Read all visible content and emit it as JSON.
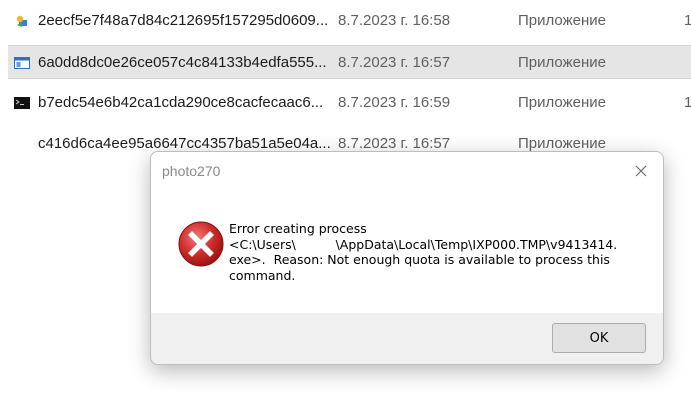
{
  "files": [
    {
      "name": "2eecf5e7f48a7d84c212695f157295d0609...",
      "date": "8.7.2023 г. 16:58",
      "type": "Приложение",
      "size": "1",
      "icon": "installer-icon",
      "selected": false
    },
    {
      "name": "6a0dd8dc0e26ce057c4c84133b4edfa555...",
      "date": "8.7.2023 г. 16:57",
      "type": "Приложение",
      "size": "",
      "icon": "app-window-icon",
      "selected": true
    },
    {
      "name": "b7edc54e6b42ca1cda290ce8cacfecaac6...",
      "date": "8.7.2023 г. 16:59",
      "type": "Приложение",
      "size": "1",
      "icon": "console-icon",
      "selected": false
    },
    {
      "name": "c416d6ca4ee95a6647cc4357ba51a5e04a...",
      "date": "8.7.2023 г. 16:57",
      "type": "Приложение",
      "size": "",
      "icon": "",
      "selected": false
    }
  ],
  "dialog": {
    "title": "photo270",
    "icon": "error-icon",
    "message_lines": [
      "Error creating process",
      "<C:\\Users\\          \\AppData\\Local\\Temp\\IXP000.TMP\\v9413414.",
      "exe>.  Reason: Not enough quota is available to process this",
      "command."
    ],
    "ok_label": "OK",
    "close_icon": "close-icon"
  },
  "colors": {
    "selected_row": "#e5e5e5",
    "error_red": "#d32f2f",
    "dialog_bg": "#f0f0f0",
    "secondary_text": "#5f5f5f"
  }
}
